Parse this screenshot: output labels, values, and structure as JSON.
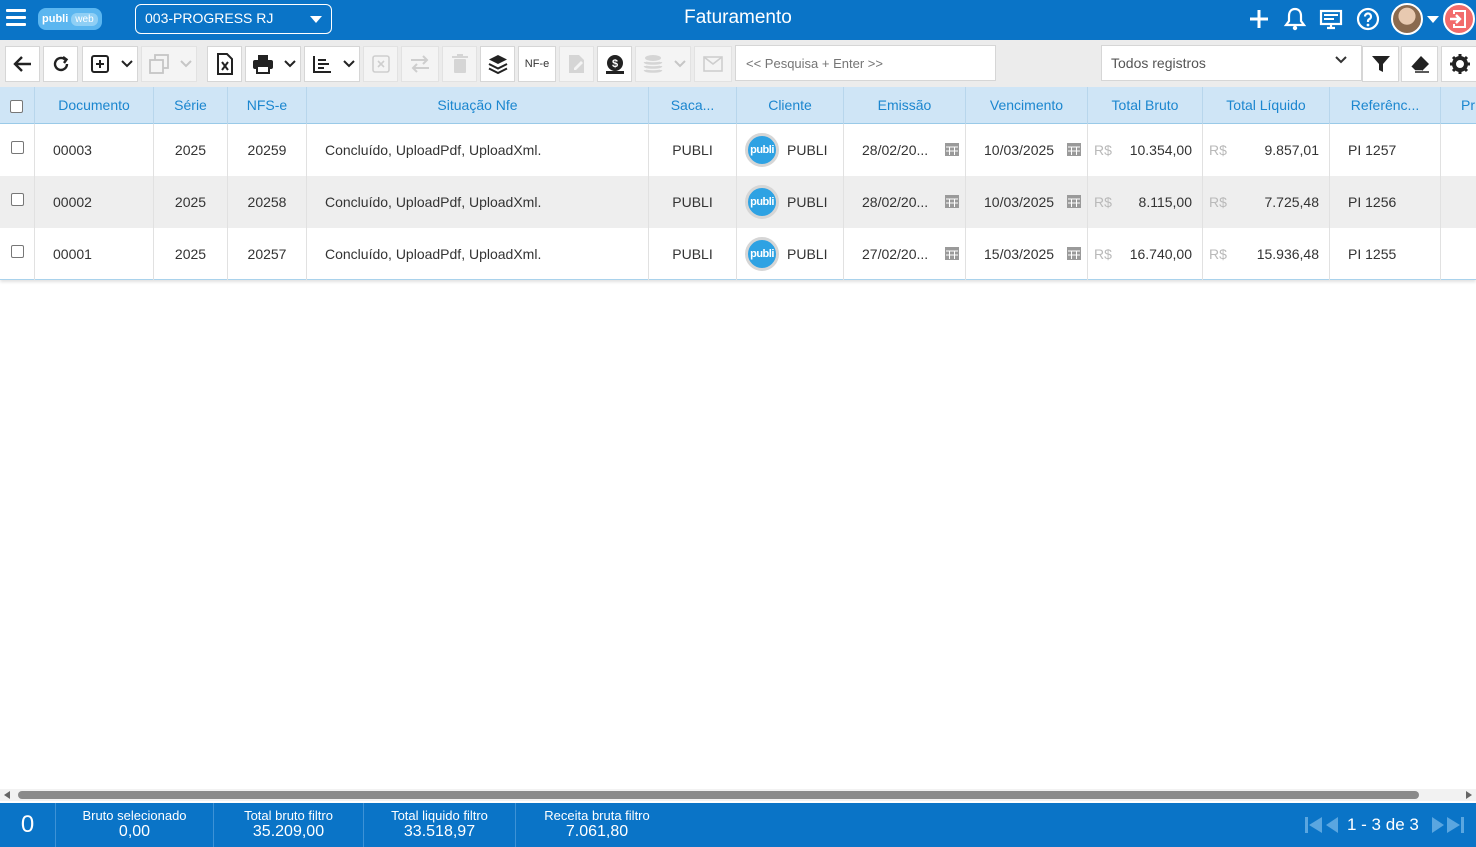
{
  "header": {
    "title": "Faturamento",
    "logo_main": "publi",
    "logo_sub": "web",
    "company_selector": "003-PROGRESS RJ",
    "accent_color": "#0a74c7"
  },
  "toolbar": {
    "nfe_label": "NF-e",
    "search_placeholder": "<< Pesquisa + Enter >>",
    "filter_select_value": "Todos registros"
  },
  "table": {
    "columns": [
      "Documento",
      "Série",
      "NFS-e",
      "Situação Nfe",
      "Saca...",
      "Cliente",
      "Emissão",
      "Vencimento",
      "Total Bruto",
      "Total Líquido",
      "Referênc...",
      "Pr"
    ],
    "currency": "R$",
    "client_logo_text": "publi",
    "rows": [
      {
        "documento": "00003",
        "serie": "2025",
        "nfse": "20259",
        "situacao": "Concluído, UploadPdf, UploadXml.",
        "sacado": "PUBLI",
        "cliente": "PUBLI",
        "emissao": "28/02/20...",
        "vencimento": "10/03/2025",
        "total_bruto": "10.354,00",
        "total_liquido": "9.857,01",
        "referencia": "PI 1257"
      },
      {
        "documento": "00002",
        "serie": "2025",
        "nfse": "20258",
        "situacao": "Concluído, UploadPdf, UploadXml.",
        "sacado": "PUBLI",
        "cliente": "PUBLI",
        "emissao": "28/02/20...",
        "vencimento": "10/03/2025",
        "total_bruto": "8.115,00",
        "total_liquido": "7.725,48",
        "referencia": "PI 1256"
      },
      {
        "documento": "00001",
        "serie": "2025",
        "nfse": "20257",
        "situacao": "Concluído, UploadPdf, UploadXml.",
        "sacado": "PUBLI",
        "cliente": "PUBLI",
        "emissao": "27/02/20...",
        "vencimento": "15/03/2025",
        "total_bruto": "16.740,00",
        "total_liquido": "15.936,48",
        "referencia": "PI 1255"
      }
    ]
  },
  "footer": {
    "selected_count": "0",
    "bruto_selecionado_label": "Bruto selecionado",
    "bruto_selecionado_value": "0,00",
    "total_bruto_filtro_label": "Total bruto filtro",
    "total_bruto_filtro_value": "35.209,00",
    "total_liquido_filtro_label": "Total liquido filtro",
    "total_liquido_filtro_value": "33.518,97",
    "receita_bruta_filtro_label": "Receita bruta filtro",
    "receita_bruta_filtro_value": "7.061,80",
    "pagination": "1 - 3 de 3"
  }
}
